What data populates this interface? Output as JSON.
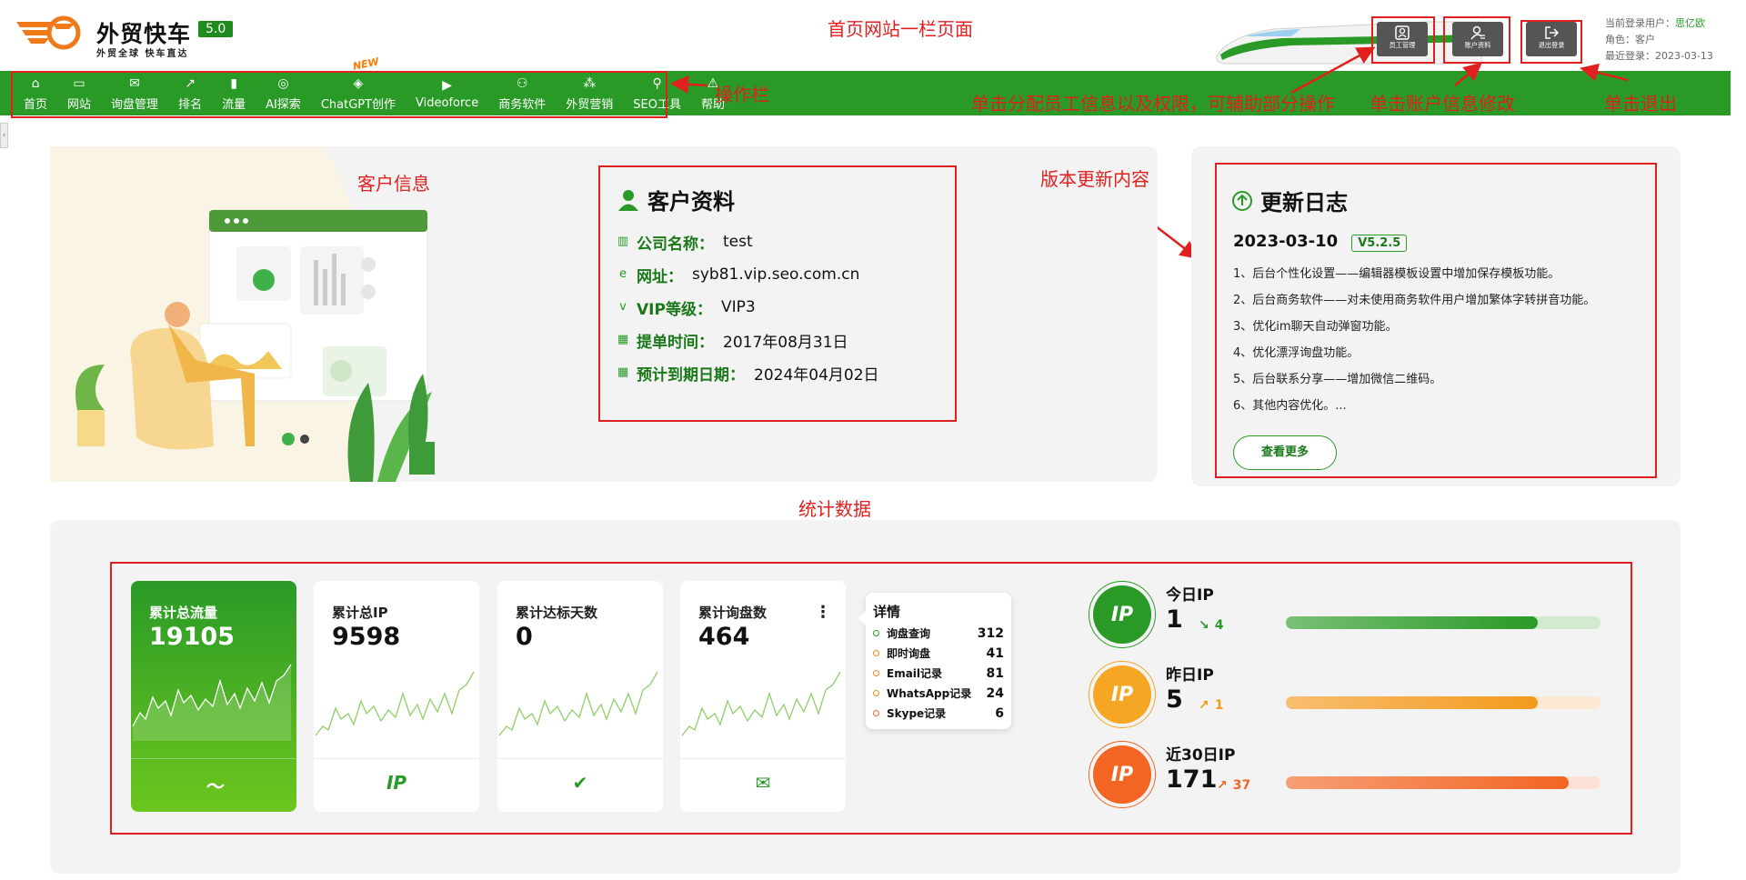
{
  "header": {
    "logo_title": "外贸快车",
    "logo_version": "5.0",
    "logo_slogan": "外贸全球 快车直达",
    "page_annotation": "首页网站一栏页面",
    "buttons": [
      {
        "label": "员工管理"
      },
      {
        "label": "账户资料"
      },
      {
        "label": "退出登录"
      }
    ],
    "user_info": {
      "login_user_label": "当前登录用户：",
      "login_user": "思亿欧",
      "role_label": "角色：",
      "role": "客户",
      "last_login_label": "最近登录：",
      "last_login": "2023-03-13"
    }
  },
  "nav": {
    "items": [
      {
        "label": "首页",
        "icon": "⌂"
      },
      {
        "label": "网站",
        "icon": "▭"
      },
      {
        "label": "询盘管理",
        "icon": "✉"
      },
      {
        "label": "排名",
        "icon": "↗"
      },
      {
        "label": "流量",
        "icon": "▮"
      },
      {
        "label": "AI探索",
        "icon": "◎"
      },
      {
        "label": "ChatGPT创作",
        "icon": "◈"
      },
      {
        "label": "Videoforce",
        "icon": "▶"
      },
      {
        "label": "商务软件",
        "icon": "⚇"
      },
      {
        "label": "外贸营销",
        "icon": "⁂"
      },
      {
        "label": "SEO工具",
        "icon": "⚲"
      },
      {
        "label": "帮助",
        "icon": "⚠"
      }
    ],
    "new_badge": "NEW"
  },
  "annotations": {
    "nav_bar": "操作栏",
    "staff": "单击分配员工信息以及权限，可辅助部分操作",
    "account": "单击账户信息修改",
    "logout": "单击退出",
    "customer_info": "客户信息",
    "version_update": "版本更新内容",
    "stats": "统计数据"
  },
  "profile": {
    "title": "客户资料",
    "rows": [
      {
        "key": "公司名称：",
        "value": "test",
        "icon": "▥"
      },
      {
        "key": "网址：",
        "value": "syb81.vip.seo.com.cn",
        "icon": "e"
      },
      {
        "key": "VIP等级：",
        "value": "VIP3",
        "icon": "v"
      },
      {
        "key": "提单时间：",
        "value": "2017年08月31日",
        "icon": "▦"
      },
      {
        "key": "预计到期日期：",
        "value": "2024年04月02日",
        "icon": "▦"
      }
    ]
  },
  "changelog": {
    "title": "更新日志",
    "date": "2023-03-10",
    "version": "V5.2.5",
    "items": [
      "1、后台个性化设置——编辑器模板设置中增加保存模板功能。",
      "2、后台商务软件——对未使用商务软件用户增加繁体字转拼音功能。",
      "3、优化im聊天自动弹窗功能。",
      "4、优化漂浮询盘功能。",
      "5、后台联系分享——增加微信二维码。",
      "6、其他内容优化。..."
    ],
    "more_label": "查看更多"
  },
  "stats": {
    "cards": [
      {
        "label": "累计总流量",
        "value": "19105",
        "icon": "〜"
      },
      {
        "label": "累计总IP",
        "value": "9598",
        "icon": "IP"
      },
      {
        "label": "累计达标天数",
        "value": "0",
        "icon": "✔"
      },
      {
        "label": "累计询盘数",
        "value": "464",
        "icon": "✉"
      }
    ],
    "menu_icon": "⋮",
    "details": {
      "title": "详情",
      "rows": [
        {
          "label": "询盘查询",
          "value": "312",
          "color": "#2a9a27"
        },
        {
          "label": "即时询盘",
          "value": "41",
          "color": "#f08c1a"
        },
        {
          "label": "Email记录",
          "value": "81",
          "color": "#f08c1a"
        },
        {
          "label": "WhatsApp记录",
          "value": "24",
          "color": "#f08c1a"
        },
        {
          "label": "Skype记录",
          "value": "6",
          "color": "#f06a2a"
        }
      ]
    },
    "ip": [
      {
        "label": "今日IP",
        "value": "1",
        "delta": "4",
        "delta_symbol": "↘",
        "progress": 0.8,
        "color": "#2a9a27",
        "bar_bg": "#d4ead0",
        "circle": "#2a9a27",
        "ring": "#2a9a27"
      },
      {
        "label": "昨日IP",
        "value": "5",
        "delta": "1",
        "delta_symbol": "↗",
        "progress": 0.8,
        "color": "#f39a1c",
        "bar_bg": "#fde8d2",
        "circle": "#f5a623",
        "ring": "#f5a623"
      },
      {
        "label": "近30日IP",
        "value": "171",
        "delta": "37",
        "delta_symbol": "↗",
        "progress": 0.9,
        "color": "#f26522",
        "bar_bg": "#fde1d6",
        "circle": "#f26522",
        "ring": "#f26522"
      }
    ],
    "ip_badge": "IP"
  }
}
